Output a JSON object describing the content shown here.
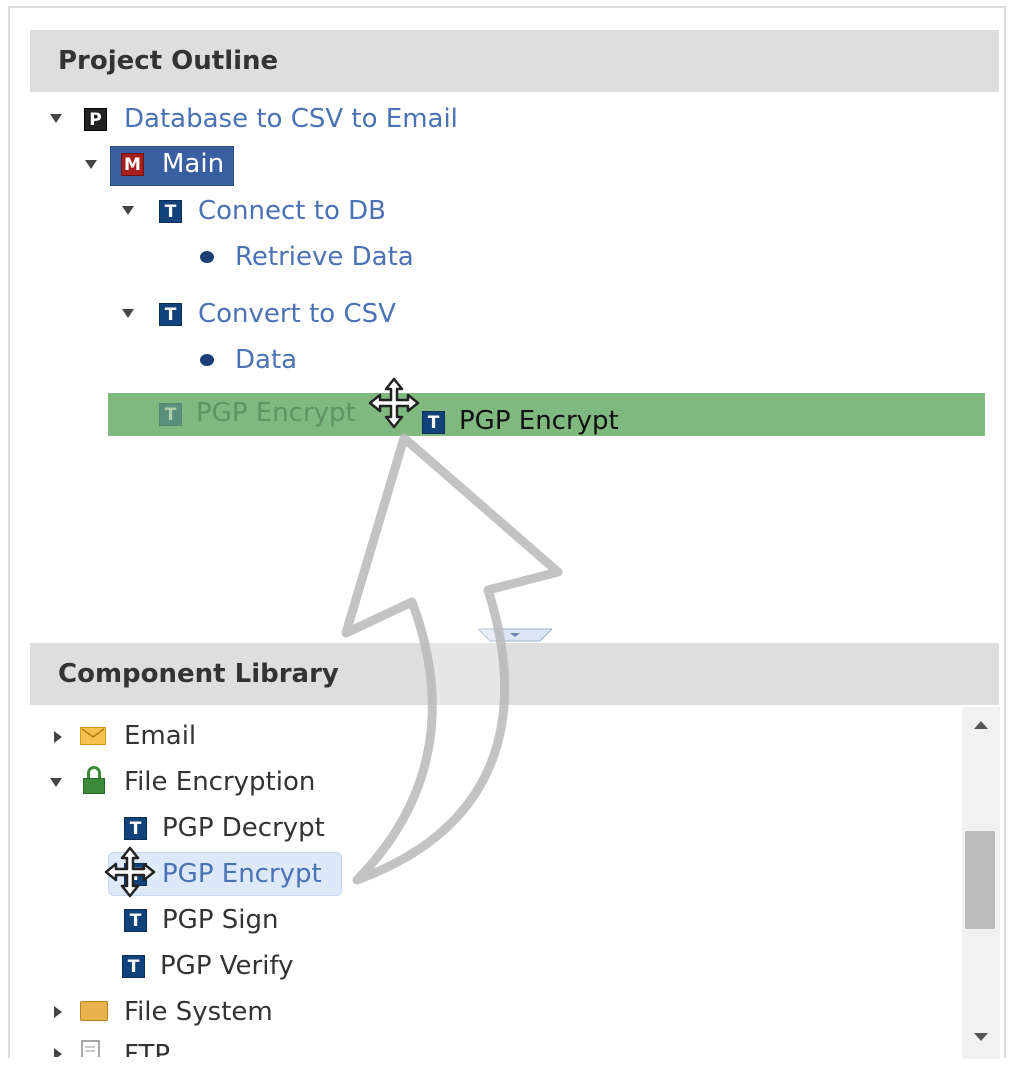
{
  "project_outline": {
    "header": "Project Outline",
    "project": {
      "label": "Database to CSV to Email",
      "badge": "P"
    },
    "module": {
      "label": "Main",
      "badge": "M"
    },
    "tasks": [
      {
        "label": "Connect to DB",
        "badge": "T",
        "child": "Retrieve Data"
      },
      {
        "label": "Convert to CSV",
        "badge": "T",
        "child": "Data"
      }
    ],
    "drop_target": {
      "ghost_label": "PGP Encrypt",
      "dragged_label": "PGP Encrypt",
      "badge": "T"
    }
  },
  "component_library": {
    "header": "Component Library",
    "categories": [
      {
        "label": "Email",
        "icon": "envelope-icon",
        "expanded": false
      },
      {
        "label": "File Encryption",
        "icon": "lock-icon",
        "expanded": true
      },
      {
        "label": "File System",
        "icon": "folder-icon",
        "expanded": false
      },
      {
        "label": "FTP",
        "icon": "document-icon",
        "expanded": false
      }
    ],
    "encryption_items": [
      {
        "label": "PGP Decrypt",
        "badge": "T"
      },
      {
        "label": "PGP Encrypt",
        "badge": "T"
      },
      {
        "label": "PGP Sign",
        "badge": "T"
      },
      {
        "label": "PGP Verify",
        "badge": "T"
      }
    ]
  },
  "colors": {
    "link": "#4a72b4",
    "drop_row": "#7fb97f",
    "selected": "#3a5fa0",
    "header_bg": "#dedede"
  }
}
